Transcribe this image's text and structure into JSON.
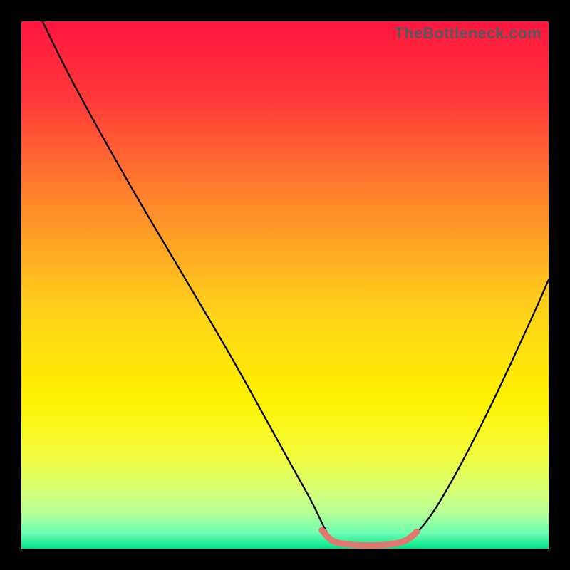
{
  "watermark": "TheBottleneck.com",
  "gradient_stops": [
    {
      "pct": 0,
      "color": "#ff153f"
    },
    {
      "pct": 15,
      "color": "#ff3a3a"
    },
    {
      "pct": 35,
      "color": "#ff8a2a"
    },
    {
      "pct": 55,
      "color": "#ffd21a"
    },
    {
      "pct": 72,
      "color": "#fef200"
    },
    {
      "pct": 82,
      "color": "#f2fb3a"
    },
    {
      "pct": 88,
      "color": "#dcff6e"
    },
    {
      "pct": 93,
      "color": "#b7ff94"
    },
    {
      "pct": 97,
      "color": "#6effb0"
    },
    {
      "pct": 100,
      "color": "#00e28a"
    }
  ],
  "chart_data": {
    "type": "line",
    "title": "",
    "xlabel": "",
    "ylabel": "",
    "xlim": [
      0,
      100
    ],
    "ylim": [
      0,
      100
    ],
    "series": [
      {
        "name": "bottleneck-curve",
        "color": "#000000",
        "points": [
          {
            "x": 4,
            "y": 100
          },
          {
            "x": 10,
            "y": 88
          },
          {
            "x": 20,
            "y": 70
          },
          {
            "x": 30,
            "y": 53
          },
          {
            "x": 40,
            "y": 36
          },
          {
            "x": 50,
            "y": 18
          },
          {
            "x": 55,
            "y": 9
          },
          {
            "x": 58,
            "y": 3
          },
          {
            "x": 60,
            "y": 1
          },
          {
            "x": 64,
            "y": 0.5
          },
          {
            "x": 68,
            "y": 0.5
          },
          {
            "x": 72,
            "y": 1
          },
          {
            "x": 75,
            "y": 3
          },
          {
            "x": 80,
            "y": 10
          },
          {
            "x": 88,
            "y": 25
          },
          {
            "x": 96,
            "y": 42
          },
          {
            "x": 100,
            "y": 51
          }
        ]
      },
      {
        "name": "optimal-band",
        "color": "#e2776e",
        "stroke_width": 9,
        "points": [
          {
            "x": 57,
            "y": 3.5
          },
          {
            "x": 59,
            "y": 1.5
          },
          {
            "x": 62,
            "y": 0.8
          },
          {
            "x": 66,
            "y": 0.6
          },
          {
            "x": 70,
            "y": 0.8
          },
          {
            "x": 73,
            "y": 1.6
          },
          {
            "x": 75,
            "y": 3.2
          }
        ]
      }
    ]
  }
}
